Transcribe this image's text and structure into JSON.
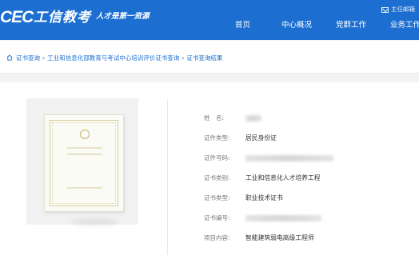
{
  "header": {
    "logo_text": "CEC",
    "logo_name": "工信教考",
    "slogan": "人才是第一资源",
    "mailbox": "主任邮箱",
    "nav": [
      "首页",
      "中心概况",
      "党群工作",
      "业务工作"
    ]
  },
  "breadcrumb": [
    "证书查询",
    "工业和信息化部教育与考试中心培训评价证书查询",
    "证书查询结果"
  ],
  "certificate": {
    "fields": [
      {
        "label": "姓　名:",
        "value": ""
      },
      {
        "label": "证件类型:",
        "value": "居民身份证"
      },
      {
        "label": "证件号码:",
        "value": ""
      },
      {
        "label": "证书类别:",
        "value": "工业和信息化人才培养工程"
      },
      {
        "label": "证书类型:",
        "value": "职业技术证书"
      },
      {
        "label": "证书编号:",
        "value": ""
      },
      {
        "label": "项目内容:",
        "value": "智能建筑弱电高级工程师"
      }
    ]
  },
  "colors": {
    "brand_blue": "#1c6fd0",
    "link_blue": "#1c6fd0",
    "label_gray": "#777777",
    "value_dark": "#333333"
  },
  "icons": {
    "breadcrumb_home": "home-icon",
    "mailbox": "mail-icon"
  }
}
